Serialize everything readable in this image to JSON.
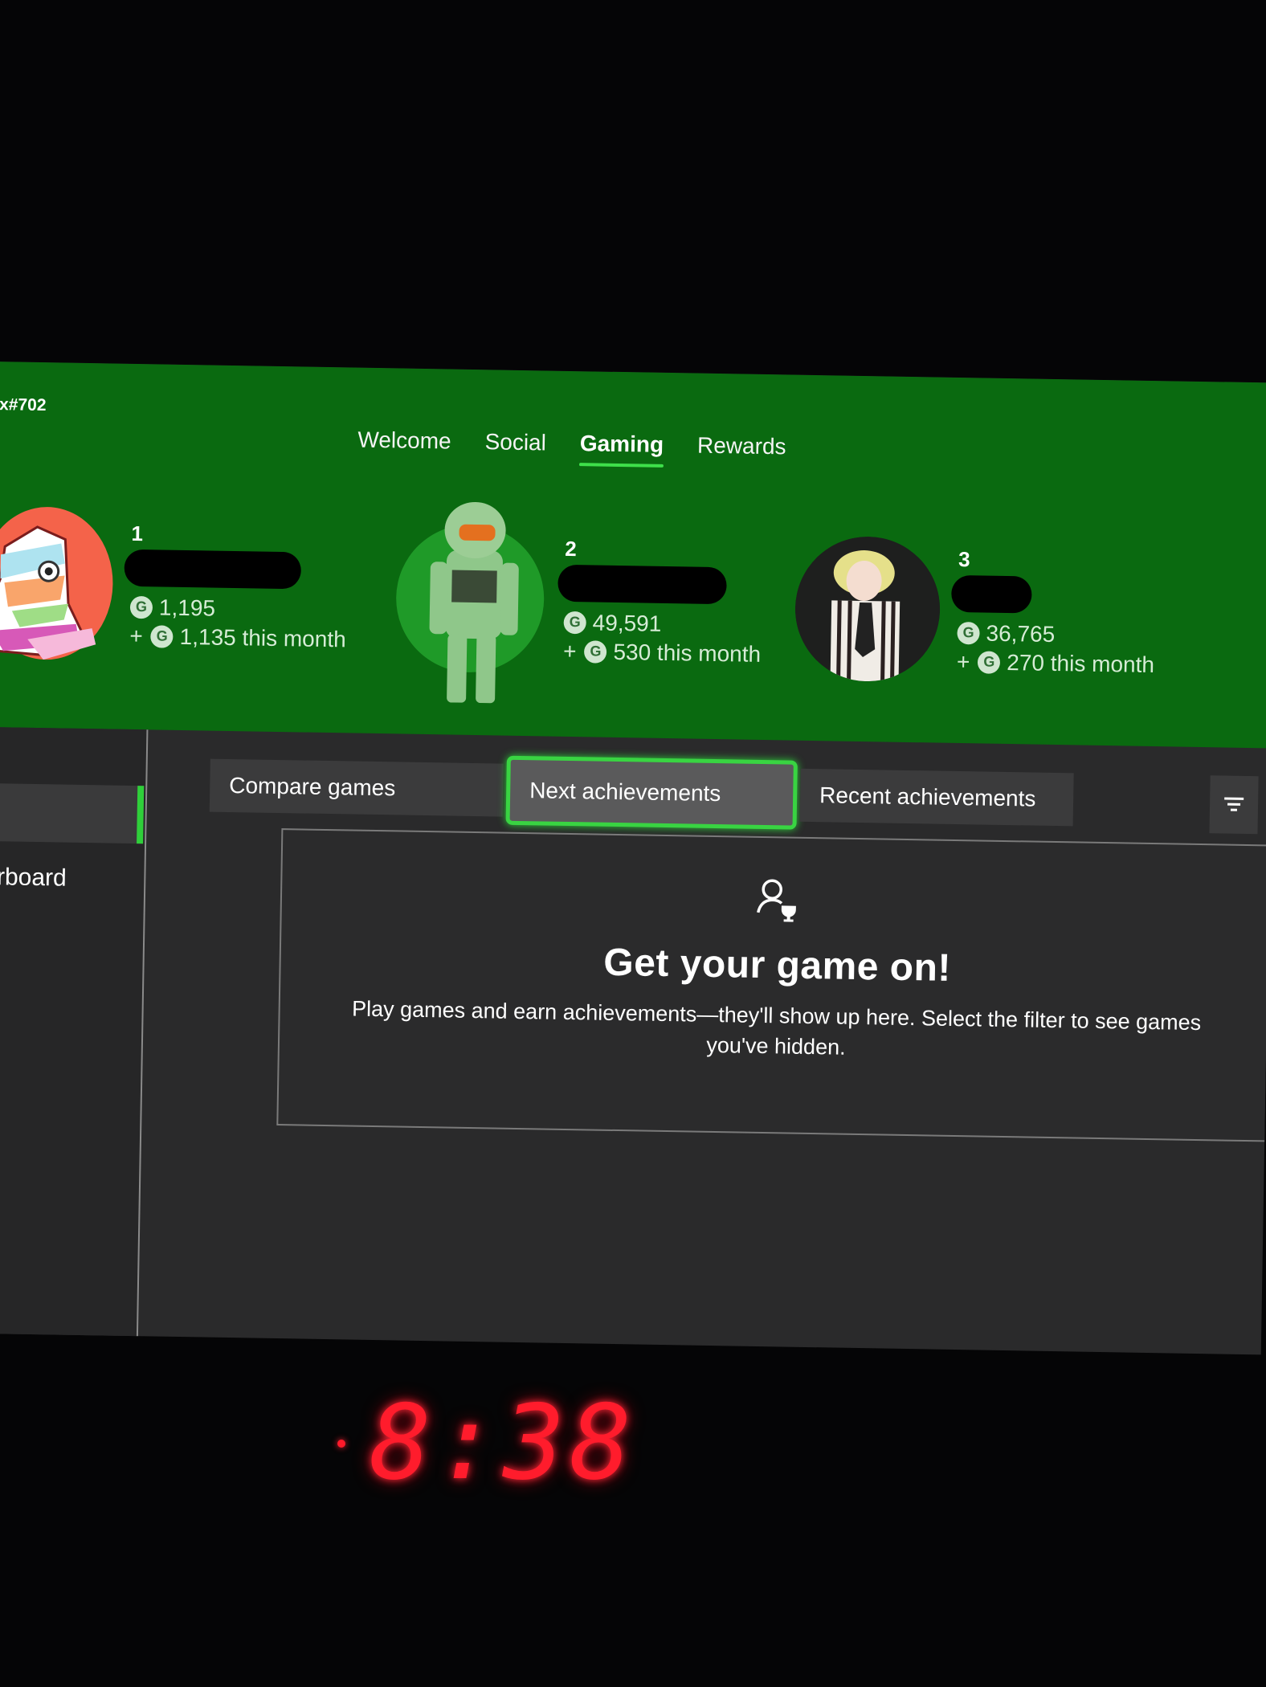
{
  "header": {
    "gamertag_partial": "x#702",
    "nav": [
      {
        "label": "Welcome",
        "active": false
      },
      {
        "label": "Social",
        "active": false
      },
      {
        "label": "Gaming",
        "active": true
      },
      {
        "label": "Rewards",
        "active": false
      }
    ],
    "accent_color": "#3ee04a",
    "background_color": "#0a6a10"
  },
  "leaderboard": [
    {
      "rank": "1",
      "name": "[redacted]",
      "gamerscore": "1,195",
      "monthly": "1,135 this month",
      "avatar": "patchwork-mummy"
    },
    {
      "rank": "2",
      "name": "[redacted]",
      "gamerscore": "49,591",
      "monthly": "530 this month",
      "avatar": "master-chief"
    },
    {
      "rank": "3",
      "name": "[redacted]",
      "gamerscore": "36,765",
      "monthly": "270 this month",
      "avatar": "beetlejuice"
    }
  ],
  "gamerscore_icon_label": "G",
  "plus_sign": "+",
  "sidebar": {
    "items": [
      {
        "label": "",
        "selected": true
      },
      {
        "label": "erboard",
        "selected": false
      }
    ]
  },
  "tabs": [
    {
      "label": "Compare games",
      "focused": false
    },
    {
      "label": "Next achievements",
      "focused": true
    },
    {
      "label": "Recent achievements",
      "focused": false
    }
  ],
  "filter_icon": "filter-icon",
  "empty_state": {
    "icon": "person-trophy-icon",
    "title": "Get your game on!",
    "body": "Play games and earn achievements—they'll show up here. Select the filter to see games you've hidden."
  },
  "clock": {
    "time": "8:38"
  }
}
